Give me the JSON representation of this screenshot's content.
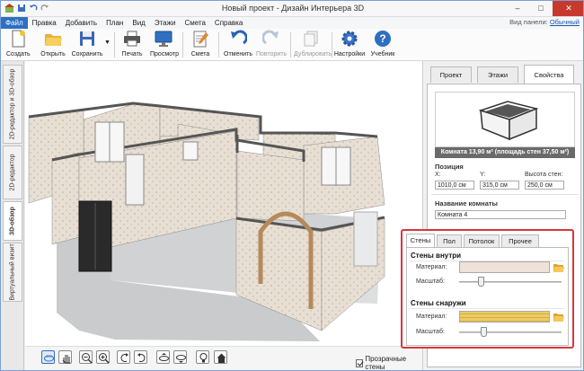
{
  "window": {
    "title": "Новый проект - Дизайн Интерьера 3D"
  },
  "menu": {
    "items": [
      "Файл",
      "Правка",
      "Добавить",
      "План",
      "Вид",
      "Этажи",
      "Смета",
      "Справка"
    ],
    "active_index": 0,
    "view_panel_label": "Вид панели:",
    "view_panel_value": "Обычный"
  },
  "toolbar": {
    "create": "Создать",
    "open": "Открыть",
    "save": "Сохранить",
    "print": "Печать",
    "preview": "Просмотр",
    "estimate": "Смета",
    "undo": "Отменить",
    "redo": "Повторить",
    "duplicate": "Дублировать",
    "settings": "Настройки",
    "tutorial": "Учебник"
  },
  "side_tabs": [
    "2D-редактор и 3D-обзор",
    "2D-редактор",
    "3D-обзор",
    "Виртуальный визит"
  ],
  "side_tab_active": 2,
  "bottom": {
    "transparent_walls": "Прозрачные стены",
    "transparent_walls_checked": true
  },
  "panel": {
    "tabs": [
      "Проект",
      "Этажи",
      "Свойства"
    ],
    "active_tab": 2,
    "room_info": "Комната 13,90 м² (площадь стен 37,50 м²)",
    "position_label": "Позиция",
    "x_label": "X:",
    "x_value": "1010,0 см",
    "y_label": "Y:",
    "y_value": "315,0 см",
    "h_label": "Высота стен:",
    "h_value": "250,0 см",
    "name_label": "Название комнаты",
    "name_value": "Комната 4"
  },
  "surfaces": {
    "tabs": [
      "Стены",
      "Пол",
      "Потолок",
      "Прочее"
    ],
    "active_tab": 0,
    "inside": {
      "title": "Стены внутри",
      "material_label": "Материал:",
      "scale_label": "Масштаб:",
      "scale": 0.2
    },
    "outside": {
      "title": "Стены снаружи",
      "material_label": "Материал:",
      "scale_label": "Масштаб:",
      "scale": 0.22
    }
  },
  "colors": {
    "accent": "#2d6fc1",
    "highlight_box": "#d8373a",
    "inside_material": "#ede1d8",
    "outside_material": "#e8c35a"
  }
}
